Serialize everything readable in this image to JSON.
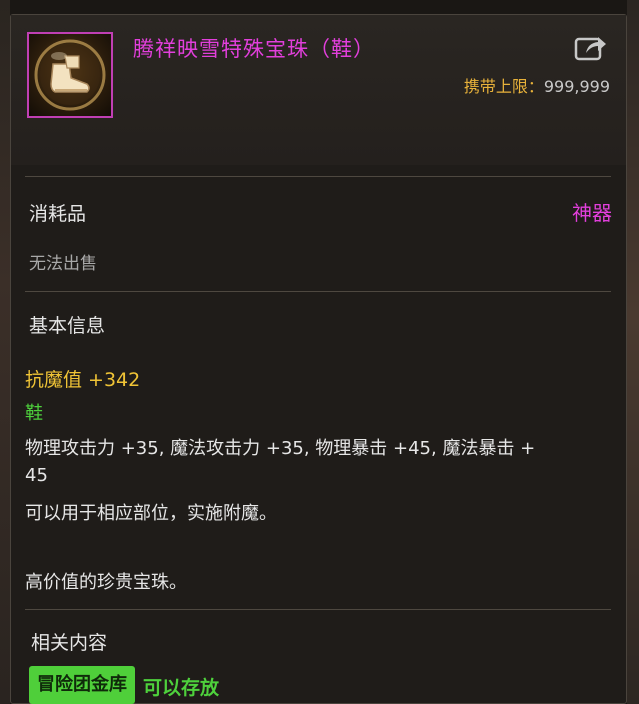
{
  "item": {
    "name": "腾祥映雪特殊宝珠（鞋）",
    "carry_label": "携带上限：",
    "carry_value": "999,999",
    "type": "消耗品",
    "rarity": "神器",
    "sell_status": "无法出售",
    "icon": "boot-orb-icon"
  },
  "basic_info": {
    "title": "基本信息",
    "resist": "抗魔值 +342",
    "slot": "鞋",
    "stats_line1": "物理攻击力 +35, 魔法攻击力 +35, 物理暴击 +45, 魔法暴击 +",
    "stats_line2": "45",
    "desc_line1": "可以用于相应部位，实施附魔。",
    "desc_line2": "高价值的珍贵宝珠。"
  },
  "related": {
    "title": "相关内容",
    "tag": "冒险团金库",
    "tag_desc": "可以存放"
  },
  "colors": {
    "epic_purple": "#e23fdc",
    "gold": "#f0c436",
    "green": "#4ed13c",
    "panel_bg": "#1f1c19"
  }
}
